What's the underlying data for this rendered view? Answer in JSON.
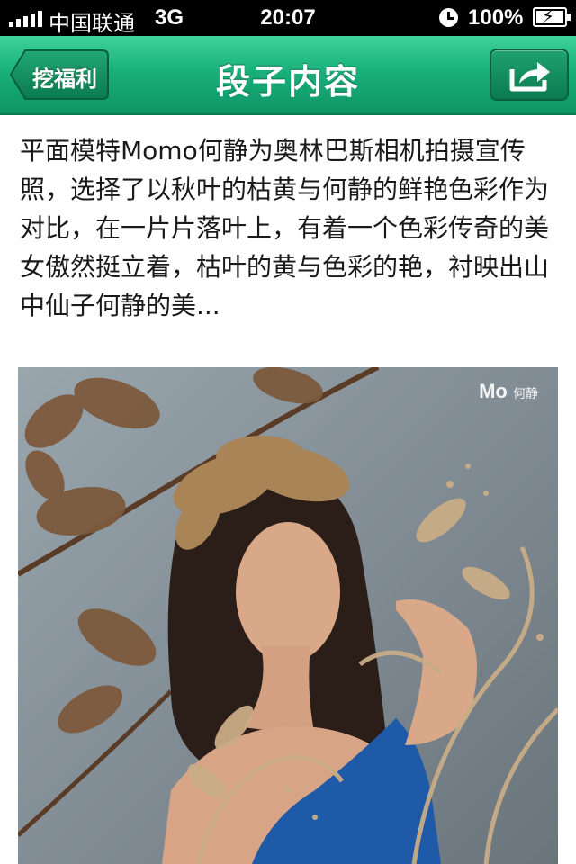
{
  "status_bar": {
    "carrier": "中国联通",
    "network": "3G",
    "time": "20:07",
    "battery": "100%"
  },
  "nav": {
    "back_label": "挖福利",
    "title": "段子内容",
    "share_icon": "share-icon"
  },
  "content": {
    "text": "平面模特Momo何静为奥林巴斯相机拍摄宣传照，选择了以秋叶的枯黄与何静的鲜艳色彩作为对比，在一片片落叶上，有着一个色彩传奇的美女傲然挺立着，枯叶的黄与色彩的艳，衬映出山中仙子何静的美..."
  },
  "photo": {
    "watermark_brand": "Mo",
    "watermark_name": "何静"
  },
  "colors": {
    "nav_green": "#19b07a",
    "status_black": "#000000"
  }
}
